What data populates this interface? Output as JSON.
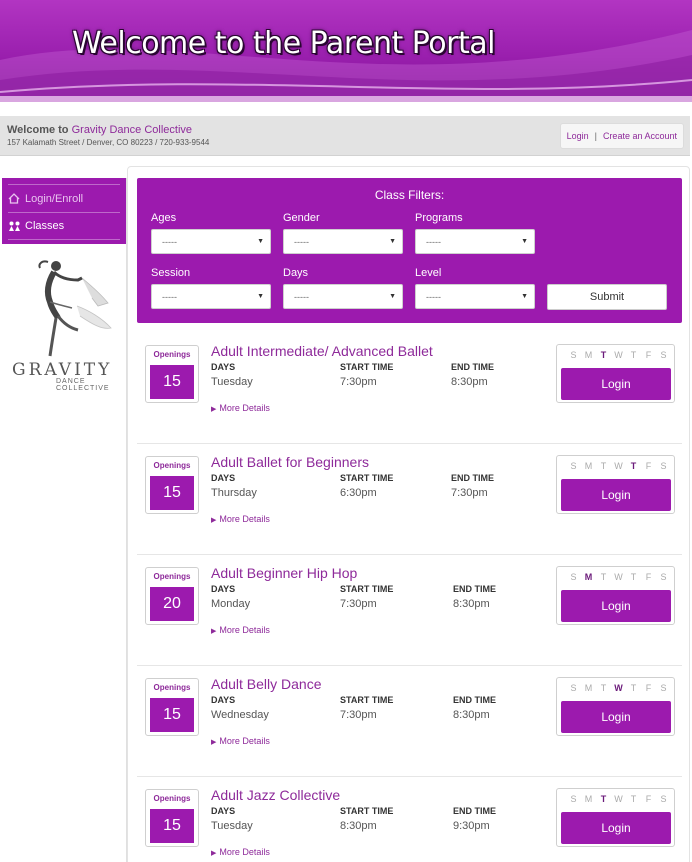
{
  "banner": {
    "title": "Welcome to the Parent Portal"
  },
  "infobar": {
    "welcome_prefix": "Welcome to",
    "org_name": "Gravity Dance Collective",
    "address": "157 Kalamath Street / Denver, CO 80223 / 720-933-9544",
    "login_link": "Login",
    "separator": "|",
    "create_account_link": "Create an Account"
  },
  "sidebar": {
    "items": [
      {
        "label": "Login/Enroll",
        "icon": "home-icon"
      },
      {
        "label": "Classes",
        "icon": "dancers-icon"
      }
    ],
    "logo": {
      "text": "GRAVITY",
      "sub_line1": "DANCE",
      "sub_line2": "COLLECTIVE"
    }
  },
  "filters": {
    "title": "Class Filters:",
    "fields": [
      {
        "label": "Ages",
        "value": "-----"
      },
      {
        "label": "Gender",
        "value": "-----"
      },
      {
        "label": "Programs",
        "value": "-----"
      },
      {
        "label": "Session",
        "value": "-----"
      },
      {
        "label": "Days",
        "value": "-----"
      },
      {
        "label": "Level",
        "value": "-----"
      }
    ],
    "submit_label": "Submit"
  },
  "labels": {
    "openings": "Openings",
    "days": "DAYS",
    "start_time": "START TIME",
    "end_time": "END TIME",
    "more_details": "More Details",
    "login": "Login",
    "weekdays": [
      "S",
      "M",
      "T",
      "W",
      "T",
      "F",
      "S"
    ]
  },
  "classes": [
    {
      "name": "Adult Intermediate/ Advanced Ballet",
      "openings": "15",
      "days": "Tuesday",
      "start": "7:30pm",
      "end": "8:30pm",
      "active_day": 2
    },
    {
      "name": "Adult Ballet for Beginners",
      "openings": "15",
      "days": "Thursday",
      "start": "6:30pm",
      "end": "7:30pm",
      "active_day": 4
    },
    {
      "name": "Adult Beginner Hip Hop",
      "openings": "20",
      "days": "Monday",
      "start": "7:30pm",
      "end": "8:30pm",
      "active_day": 1
    },
    {
      "name": "Adult Belly Dance",
      "openings": "15",
      "days": "Wednesday",
      "start": "7:30pm",
      "end": "8:30pm",
      "active_day": 3
    },
    {
      "name": "Adult Jazz Collective",
      "openings": "15",
      "days": "Tuesday",
      "start": "8:30pm",
      "end": "9:30pm",
      "active_day": 2
    }
  ],
  "colors": {
    "brand": "#9c1aae",
    "link": "#8e2a9a"
  }
}
